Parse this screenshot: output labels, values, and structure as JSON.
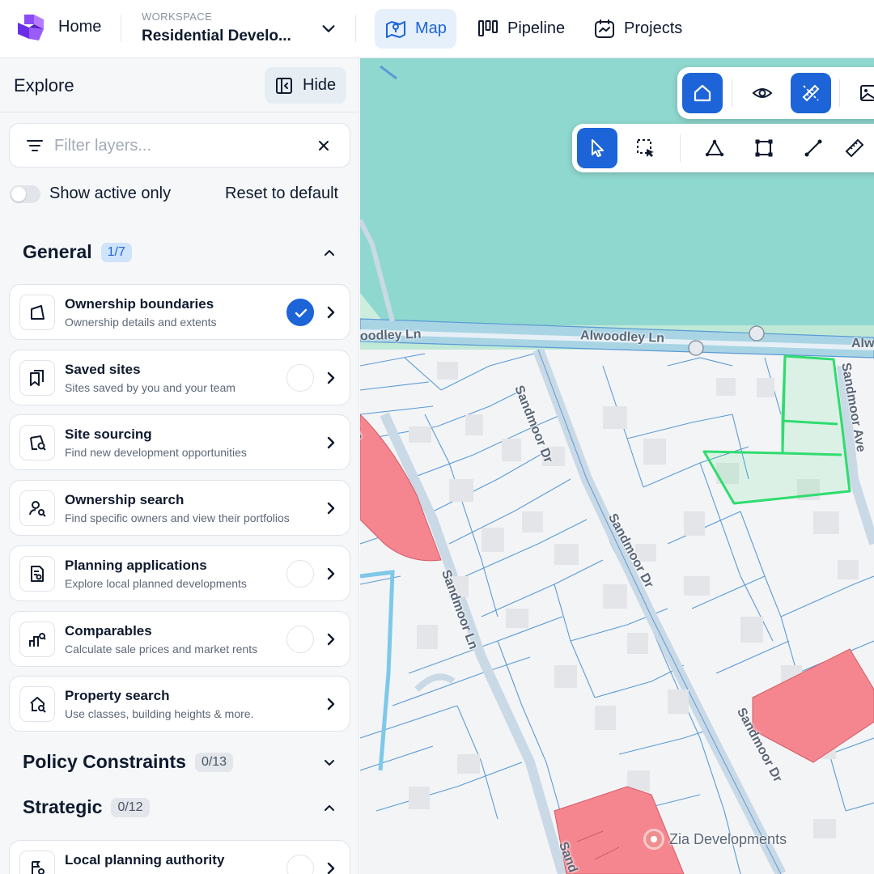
{
  "header": {
    "home_label": "Home",
    "workspace_label": "WORKSPACE",
    "workspace_name": "Residential Develo...",
    "tabs": [
      {
        "label": "Map",
        "active": true,
        "icon": "map-icon"
      },
      {
        "label": "Pipeline",
        "active": false,
        "icon": "pipeline-icon"
      },
      {
        "label": "Projects",
        "active": false,
        "icon": "projects-icon"
      }
    ]
  },
  "sidebar": {
    "title": "Explore",
    "hide_label": "Hide",
    "filter_placeholder": "Filter layers...",
    "filter_value": "",
    "show_active_label": "Show active only",
    "show_active_on": false,
    "reset_label": "Reset to default",
    "sections": [
      {
        "title": "General",
        "count": "1/7",
        "expanded": true
      },
      {
        "title": "Policy Constraints",
        "count": "0/13",
        "expanded": false
      },
      {
        "title": "Strategic",
        "count": "0/12",
        "expanded": true
      }
    ],
    "general_items": [
      {
        "title": "Ownership boundaries",
        "subtitle": "Ownership details and extents",
        "checkbox": true,
        "checked": true,
        "icon": "boundary-icon"
      },
      {
        "title": "Saved sites",
        "subtitle": "Sites saved by you and your team",
        "checkbox": true,
        "checked": false,
        "icon": "saved-sites-icon"
      },
      {
        "title": "Site sourcing",
        "subtitle": "Find new development opportunities",
        "checkbox": false,
        "checked": false,
        "icon": "site-sourcing-icon"
      },
      {
        "title": "Ownership search",
        "subtitle": "Find specific owners and view their portfolios",
        "checkbox": false,
        "checked": false,
        "icon": "owner-search-icon"
      },
      {
        "title": "Planning applications",
        "subtitle": "Explore local planned developments",
        "checkbox": true,
        "checked": false,
        "icon": "planning-doc-icon"
      },
      {
        "title": "Comparables",
        "subtitle": "Calculate sale prices and market rents",
        "checkbox": true,
        "checked": false,
        "icon": "comparables-icon"
      },
      {
        "title": "Property search",
        "subtitle": "Use classes, building heights & more.",
        "checkbox": false,
        "checked": false,
        "icon": "property-search-icon"
      }
    ],
    "strategic_items": [
      {
        "title": "Local planning authority",
        "subtitle": "",
        "checkbox": true,
        "checked": false,
        "icon": "planning-authority-icon"
      }
    ]
  },
  "map": {
    "labels": {
      "street_1": "oodley Ln",
      "street_2": "Alwoodley Ln",
      "street_3": "Alw",
      "street_4": "Sandmoor Dr",
      "street_5": "Sandmoor Ave",
      "street_6": "Sandmoor Dr",
      "street_7": "Sandmoor Ln",
      "street_8": "Sandmoor Dr",
      "street_9": "Ln",
      "street_10": "Sand"
    },
    "poi_label": "Zia Developments",
    "colors": {
      "water": "#8fd8cf",
      "road": "#c9d9e6",
      "parcel_line": "#5b9bd5",
      "highlight": "#2fdc6f",
      "owned_parcel": "#f5868f",
      "accent": "#1c64d8"
    },
    "view_tools": [
      {
        "icon": "home-icon",
        "active": true
      },
      {
        "icon": "eye-icon",
        "active": false
      },
      {
        "icon": "measure-tools-icon",
        "active": true
      },
      {
        "icon": "image-icon",
        "active": false
      }
    ],
    "draw_tools": [
      {
        "icon": "pointer-icon",
        "active": true
      },
      {
        "icon": "select-area-icon",
        "active": false
      },
      {
        "icon": "polygon-icon",
        "active": false
      },
      {
        "icon": "rectangle-icon",
        "active": false
      },
      {
        "icon": "line-icon",
        "active": false
      },
      {
        "icon": "ruler-icon",
        "active": false
      }
    ]
  }
}
